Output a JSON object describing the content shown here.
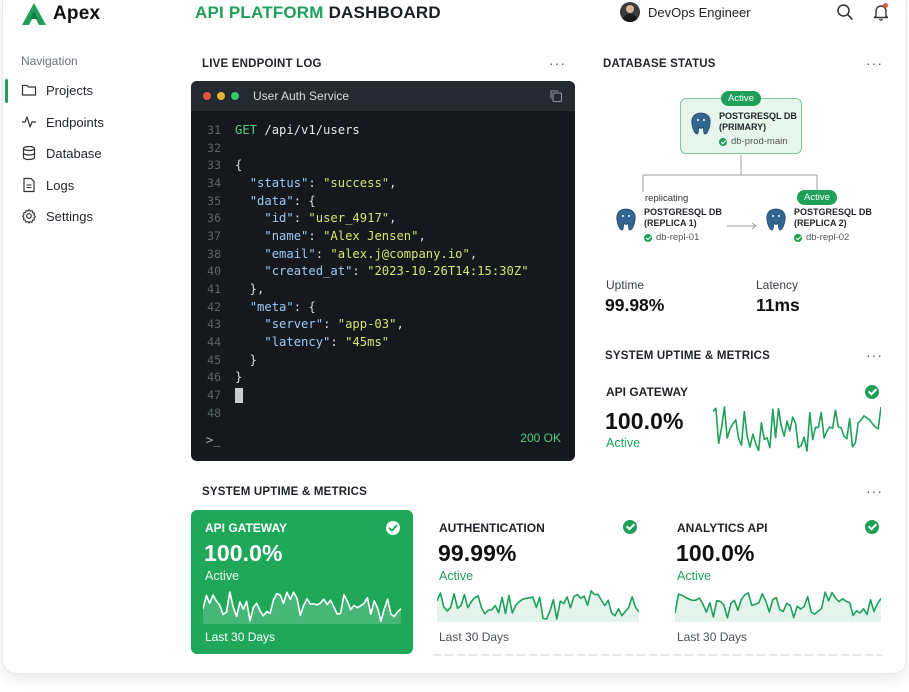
{
  "brand": {
    "name": "Apex",
    "accent": "#1ea05a"
  },
  "header": {
    "title_accent": "API PLATFORM",
    "title_rest": "DASHBOARD",
    "user_name": "DevOps Engineer"
  },
  "sidebar": {
    "heading": "Navigation",
    "items": [
      {
        "label": "Projects",
        "icon": "folder-icon",
        "active": true
      },
      {
        "label": "Endpoints",
        "icon": "pulse-icon"
      },
      {
        "label": "Database",
        "icon": "database-icon"
      },
      {
        "label": "Logs",
        "icon": "document-icon"
      },
      {
        "label": "Settings",
        "icon": "gear-icon"
      }
    ]
  },
  "endpoint_log": {
    "title": "LIVE ENDPOINT LOG",
    "tab": "User Auth Service",
    "lines": [
      {
        "n": "31",
        "tokens": [
          [
            "method",
            "GET"
          ],
          [
            "path",
            " /api/v1/users"
          ]
        ]
      },
      {
        "n": "32",
        "tokens": []
      },
      {
        "n": "33",
        "tokens": [
          [
            "punc",
            "{"
          ]
        ]
      },
      {
        "n": "34",
        "tokens": [
          [
            "punc",
            "  "
          ],
          [
            "key",
            "\"status\""
          ],
          [
            "punc",
            ": "
          ],
          [
            "str",
            "\"success\""
          ],
          [
            "punc",
            ","
          ]
        ]
      },
      {
        "n": "35",
        "tokens": [
          [
            "punc",
            "  "
          ],
          [
            "key",
            "\"data\""
          ],
          [
            "punc",
            ": {"
          ]
        ]
      },
      {
        "n": "36",
        "tokens": [
          [
            "punc",
            "    "
          ],
          [
            "key",
            "\"id\""
          ],
          [
            "punc",
            ": "
          ],
          [
            "str",
            "\"user_4917\""
          ],
          [
            "punc",
            ","
          ]
        ]
      },
      {
        "n": "37",
        "tokens": [
          [
            "punc",
            "    "
          ],
          [
            "key",
            "\"name\""
          ],
          [
            "punc",
            ": "
          ],
          [
            "str",
            "\"Alex Jensen\""
          ],
          [
            "punc",
            ","
          ]
        ]
      },
      {
        "n": "38",
        "tokens": [
          [
            "punc",
            "    "
          ],
          [
            "key",
            "\"email\""
          ],
          [
            "punc",
            ": "
          ],
          [
            "str",
            "\"alex.j@company.io\""
          ],
          [
            "punc",
            ","
          ]
        ]
      },
      {
        "n": "40",
        "tokens": [
          [
            "punc",
            "    "
          ],
          [
            "key",
            "\"created_at\""
          ],
          [
            "punc",
            ": "
          ],
          [
            "str",
            "\"2023-10-26T14:15:30Z\""
          ]
        ]
      },
      {
        "n": "41",
        "tokens": [
          [
            "punc",
            "  },"
          ]
        ]
      },
      {
        "n": "42",
        "tokens": [
          [
            "punc",
            "  "
          ],
          [
            "key",
            "\"meta\""
          ],
          [
            "punc",
            ": {"
          ]
        ]
      },
      {
        "n": "43",
        "tokens": [
          [
            "punc",
            "    "
          ],
          [
            "key",
            "\"server\""
          ],
          [
            "punc",
            ": "
          ],
          [
            "str",
            "\"app-03\""
          ],
          [
            "punc",
            ","
          ]
        ]
      },
      {
        "n": "44",
        "tokens": [
          [
            "punc",
            "    "
          ],
          [
            "key",
            "\"latency\""
          ],
          [
            "punc",
            ": "
          ],
          [
            "str",
            "\"45ms\""
          ]
        ]
      },
      {
        "n": "45",
        "tokens": [
          [
            "punc",
            "  }"
          ]
        ]
      },
      {
        "n": "46",
        "tokens": [
          [
            "punc",
            "}"
          ]
        ]
      },
      {
        "n": "47",
        "tokens": [
          [
            "cursor",
            ""
          ]
        ]
      },
      {
        "n": "48",
        "tokens": []
      }
    ],
    "prompt": ">_",
    "status": "200 OK"
  },
  "database": {
    "title": "DATABASE STATUS",
    "primary": {
      "badge": "Active",
      "name_line1": "POSTGRESQL DB",
      "name_line2": "(PRIMARY)",
      "host": "db-prod-main"
    },
    "replica1": {
      "badge": "replicating",
      "name_line1": "POSTGRESQL DB",
      "name_line2": "(REPLICA 1)",
      "host": "db-repl-01"
    },
    "replica2": {
      "badge": "Active",
      "name_line1": "POSTGRESQL DB",
      "name_line2": "(REPLICA 2)",
      "host": "db-repl-02"
    },
    "uptime_label": "Uptime",
    "uptime_value": "99.98%",
    "latency_label": "Latency",
    "latency_value": "11ms"
  },
  "side_metrics": {
    "title": "SYSTEM UPTIME & METRICS",
    "card": {
      "label": "API GATEWAY",
      "value": "100.0%",
      "status": "Active"
    }
  },
  "bottom_metrics": {
    "title": "SYSTEM UPTIME & METRICS",
    "cards": [
      {
        "label": "API GATEWAY",
        "value": "100.0%",
        "status": "Active",
        "range": "Last 30 Days"
      },
      {
        "label": "AUTHENTICATION",
        "value": "99.99%",
        "status": "Active",
        "range": "Last 30 Days"
      },
      {
        "label": "ANALYTICS API",
        "value": "100.0%",
        "status": "Active",
        "range": "Last 30 Days"
      }
    ]
  }
}
